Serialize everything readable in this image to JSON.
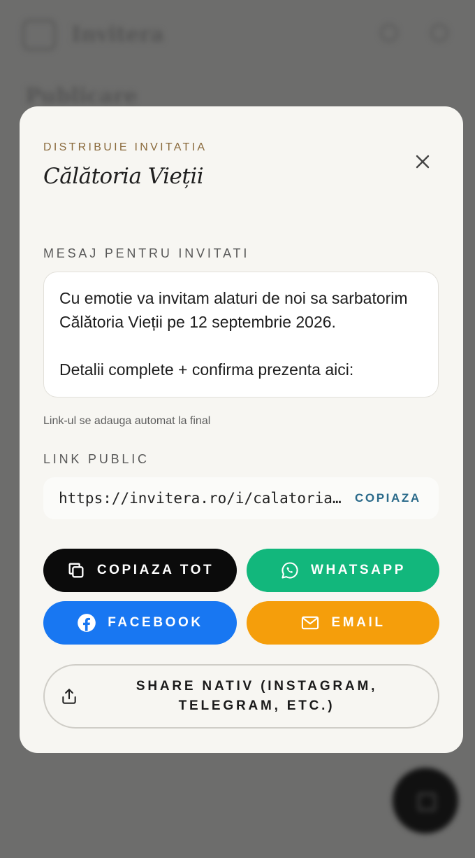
{
  "background": {
    "brand": "Invitera",
    "heading": "Publicare"
  },
  "modal": {
    "eyebrow": "DISTRIBUIE INVITATIA",
    "title": "Călătoria Vieții",
    "close_icon": "close-icon"
  },
  "message": {
    "label": "MESAJ PENTRU INVITATI",
    "value": "Cu emotie va invitam alaturi de noi sa sarbatorim Călătoria Vieții pe 12 septembrie 2026.\n\nDetalii complete + confirma prezenta aici:",
    "helper": "Link-ul se adauga automat la final"
  },
  "public_link": {
    "label": "LINK PUBLIC",
    "url": "https://invitera.ro/i/calatoria-vietii",
    "copy_label": "COPIAZA"
  },
  "share": {
    "copy_all": {
      "label": "COPIAZA TOT",
      "icon": "copy-icon",
      "color": "#0b0b0b"
    },
    "whatsapp": {
      "label": "WHATSAPP",
      "icon": "whatsapp-icon",
      "color": "#12b77c"
    },
    "facebook": {
      "label": "FACEBOOK",
      "icon": "facebook-icon",
      "color": "#1877f2"
    },
    "email": {
      "label": "EMAIL",
      "icon": "mail-icon",
      "color": "#f59e0b"
    },
    "native": {
      "label": "SHARE NATIV (INSTAGRAM, TELEGRAM, ETC.)",
      "icon": "share-icon"
    }
  }
}
